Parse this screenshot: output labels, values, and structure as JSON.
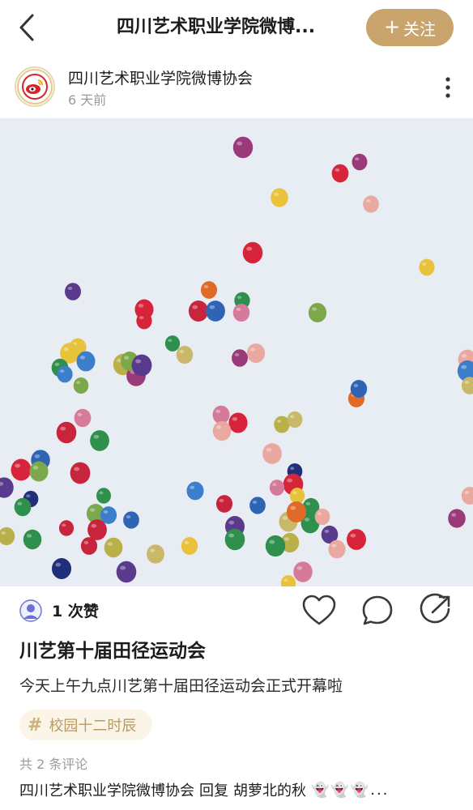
{
  "header": {
    "title": "四川艺术职业学院微博...",
    "follow_plus": "+",
    "follow_label": "关注"
  },
  "author": {
    "name": "四川艺术职业学院微博协会",
    "time": "6 天前"
  },
  "post": {
    "like_count": "1 次赞",
    "title": "川艺第十届田径运动会",
    "body": "今天上午九点川艺第十届田径运动会正式开幕啦",
    "tag_symbol": "#",
    "tag": "校园十二时辰",
    "comments_count": "共 2 条评论"
  },
  "comment_preview": {
    "author": "四川艺术职业学院微博协会",
    "action": "回复",
    "target": "胡萝北的秋",
    "emoji": "👻👻👻..."
  },
  "colors": {
    "accent": "#c9a46c",
    "sky": "#e8ecf3",
    "tag_bg": "#fbf5e8"
  },
  "icons": [
    "back-arrow-icon",
    "more-vertical-icon",
    "heart-icon",
    "comment-bubble-icon",
    "share-arrow-icon",
    "hashtag-icon",
    "weibo-logo-icon"
  ]
}
